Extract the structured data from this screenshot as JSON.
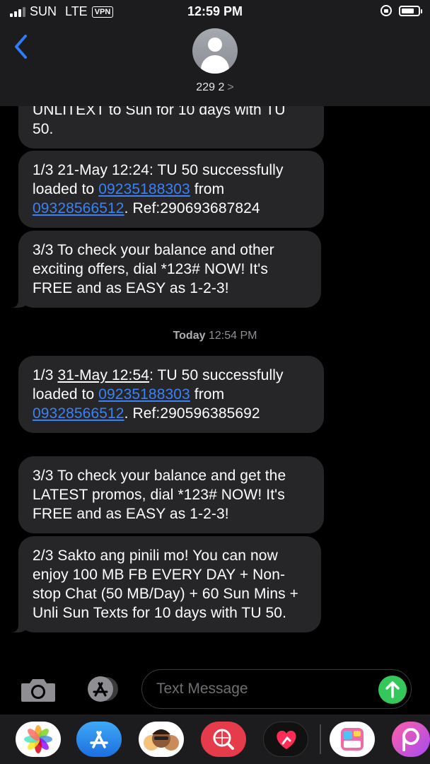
{
  "status_bar": {
    "carrier": "SUN",
    "network": "LTE",
    "vpn": "VPN",
    "time": "12:59 PM"
  },
  "header": {
    "contact": "229 2",
    "chevron": ">"
  },
  "messages": [
    {
      "id": "m0",
      "parts": [
        {
          "t": "UNLITEXT to Sun for 10 days with TU 50."
        }
      ]
    },
    {
      "id": "m1",
      "parts": [
        {
          "t": "1/3 21-May 12:24: TU 50 successfully loaded to "
        },
        {
          "t": "09235188303",
          "link": true
        },
        {
          "t": " from "
        },
        {
          "t": "09328566512",
          "link": true
        },
        {
          "t": ". Ref:290693687824"
        }
      ]
    },
    {
      "id": "m2",
      "parts": [
        {
          "t": "3/3 To check your balance and other exciting offers, dial *123# NOW! It's FREE and as EASY as 1-2-3!"
        }
      ]
    },
    {
      "id": "m3",
      "parts": [
        {
          "t": "1/3 "
        },
        {
          "t": "31-May 12:54",
          "underline": true
        },
        {
          "t": ": TU 50 successfully loaded to "
        },
        {
          "t": "09235188303",
          "link": true
        },
        {
          "t": " from "
        },
        {
          "t": "09328566512",
          "link": true
        },
        {
          "t": ". Ref:290596385692"
        }
      ]
    },
    {
      "id": "m4",
      "parts": [
        {
          "t": "3/3 To check your balance and get the LATEST promos, dial *123# NOW! It's FREE and as EASY as 1-2-3!"
        }
      ]
    },
    {
      "id": "m5",
      "parts": [
        {
          "t": "2/3 Sakto ang pinili mo! You can now enjoy 100 MB FB EVERY DAY + Non-stop Chat (50 MB/Day) + 60 Sun Mins + Unli Sun Texts for 10 days with TU 50."
        }
      ]
    }
  ],
  "timestamp": {
    "day": "Today",
    "time": "12:54 PM"
  },
  "input": {
    "placeholder": "Text Message"
  },
  "icons": {
    "back": "chevron-left-icon",
    "camera": "camera-icon",
    "appstore": "app-store-icon",
    "send": "arrow-up-icon"
  },
  "app_drawer": [
    "photos",
    "app-store",
    "memoji",
    "search-globe",
    "digital-touch",
    "collage",
    "picsart"
  ],
  "colors": {
    "bubble": "#262628",
    "link": "#3b82f6",
    "send": "#34c759",
    "header": "#1c1c1e"
  },
  "battery_level": 0.75
}
